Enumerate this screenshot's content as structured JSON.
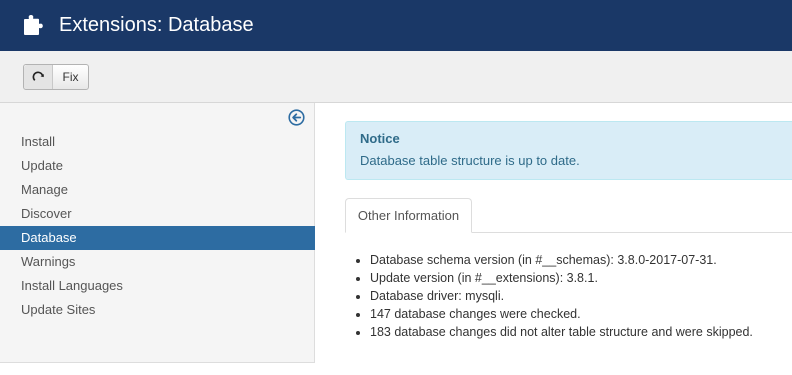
{
  "header": {
    "title": "Extensions: Database",
    "icon": "puzzle-icon"
  },
  "toolbar": {
    "fix_label": "Fix",
    "fix_icon": "refresh-icon"
  },
  "sidebar": {
    "collapse_icon": "arrow-left-circle-icon",
    "items": [
      {
        "label": "Install"
      },
      {
        "label": "Update"
      },
      {
        "label": "Manage"
      },
      {
        "label": "Discover"
      },
      {
        "label": "Database",
        "active": true
      },
      {
        "label": "Warnings"
      },
      {
        "label": "Install Languages"
      },
      {
        "label": "Update Sites"
      }
    ]
  },
  "notice": {
    "title": "Notice",
    "text": "Database table structure is up to date."
  },
  "tabs": [
    {
      "label": "Other Information"
    }
  ],
  "info": [
    "Database schema version (in #__schemas): 3.8.0-2017-07-31.",
    "Update version (in #__extensions): 3.8.1.",
    "Database driver: mysqli.",
    "147 database changes were checked.",
    "183 database changes did not alter table structure and were skipped."
  ],
  "colors": {
    "header_bg": "#1a3867",
    "active_nav": "#2d6ca2",
    "notice_bg": "#d9edf7",
    "notice_text": "#2f6b89"
  }
}
